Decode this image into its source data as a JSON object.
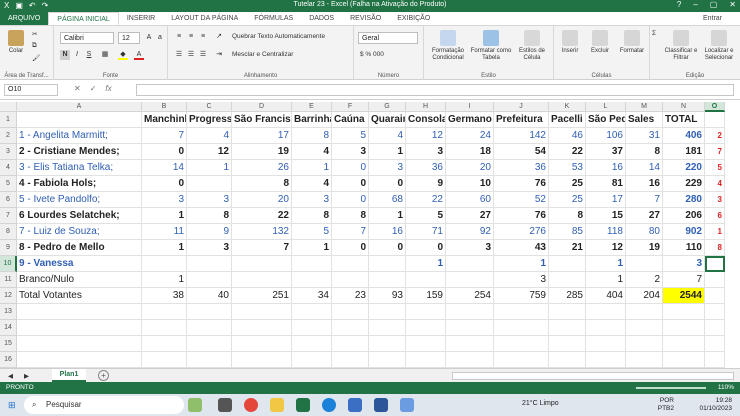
{
  "titlebar": {
    "title": "Tutelar 23 - Excel (Falha na Ativação do Produto)"
  },
  "tabs": [
    "ARQUIVO",
    "PÁGINA INICIAL",
    "INSERIR",
    "LAYOUT DA PÁGINA",
    "FÓRMULAS",
    "DADOS",
    "REVISÃO",
    "EXIBIÇÃO"
  ],
  "signin": "Entrar",
  "ribbon": {
    "paste": "Colar",
    "clipboard": "Área de Transf...",
    "font_name": "Calibri",
    "font_size": "12",
    "font_group": "Fonte",
    "wrap": "Quebrar Texto Automaticamente",
    "merge": "Mesclar e Centralizar",
    "align_group": "Alinhamento",
    "number_format": "Geral",
    "number_group": "Número",
    "cond_format": "Formatação Condicional",
    "format_table": "Formatar como Tabela",
    "cell_styles": "Estilos de Célula",
    "styles_group": "Estilo",
    "insert": "Inserir",
    "delete": "Excluir",
    "format": "Formatar",
    "cells_group": "Células",
    "sort": "Classificar e Filtrar",
    "find": "Localizar e Selecionar",
    "edit_group": "Edição"
  },
  "formula_bar": {
    "name_box": "O10",
    "fx": "fx",
    "value": ""
  },
  "columns": [
    "A",
    "B",
    "C",
    "D",
    "E",
    "F",
    "G",
    "H",
    "I",
    "J",
    "K",
    "L",
    "M",
    "N",
    "O"
  ],
  "rows": [
    {
      "n": "1",
      "cells": [
        "",
        "Manchinha",
        "Progresso",
        "São Francisco",
        "Barrinha",
        "Caúna",
        "Quarain",
        "Consolação",
        "Germano",
        "Prefeitura",
        "Pacelli",
        "São Pedro",
        "Sales",
        "TOTAL",
        ""
      ]
    },
    {
      "n": "2",
      "cells": [
        "1 - Angelita Marmitt;",
        "7",
        "4",
        "17",
        "8",
        "5",
        "4",
        "12",
        "24",
        "142",
        "46",
        "106",
        "31",
        "406",
        "2"
      ]
    },
    {
      "n": "3",
      "cells": [
        "2 - Cristiane Mendes;",
        "0",
        "12",
        "19",
        "4",
        "3",
        "1",
        "3",
        "18",
        "54",
        "22",
        "37",
        "8",
        "181",
        "7"
      ]
    },
    {
      "n": "4",
      "cells": [
        "3 - Elis Tatiana Telka;",
        "14",
        "1",
        "26",
        "1",
        "0",
        "3",
        "36",
        "20",
        "36",
        "53",
        "16",
        "14",
        "220",
        "5"
      ]
    },
    {
      "n": "5",
      "cells": [
        "4 - Fabiola Hols;",
        "0",
        "",
        "8",
        "4",
        "0",
        "0",
        "9",
        "10",
        "76",
        "25",
        "81",
        "16",
        "229",
        "4"
      ]
    },
    {
      "n": "6",
      "cells": [
        "5 - Ivete Pandolfo;",
        "3",
        "3",
        "20",
        "3",
        "0",
        "68",
        "22",
        "60",
        "52",
        "25",
        "17",
        "7",
        "280",
        "3"
      ]
    },
    {
      "n": "7",
      "cells": [
        "6 Lourdes Selatchek;",
        "1",
        "8",
        "22",
        "8",
        "8",
        "1",
        "5",
        "27",
        "76",
        "8",
        "15",
        "27",
        "206",
        "6"
      ]
    },
    {
      "n": "8",
      "cells": [
        "7 - Luiz de Souza;",
        "11",
        "9",
        "132",
        "5",
        "7",
        "16",
        "71",
        "92",
        "276",
        "85",
        "118",
        "80",
        "902",
        "1"
      ]
    },
    {
      "n": "9",
      "cells": [
        "8 - Pedro de Mello",
        "1",
        "3",
        "7",
        "1",
        "0",
        "0",
        "0",
        "3",
        "43",
        "21",
        "12",
        "19",
        "110",
        "8"
      ]
    },
    {
      "n": "10",
      "cells": [
        "9 - Vanessa",
        "",
        "",
        "",
        "",
        "",
        "",
        "1",
        "",
        "1",
        "",
        "1",
        "",
        "3",
        ""
      ]
    },
    {
      "n": "11",
      "cells": [
        "Branco/Nulo",
        "1",
        "",
        "",
        "",
        "",
        "",
        "",
        "",
        "3",
        "",
        "1",
        "2",
        "7",
        ""
      ]
    },
    {
      "n": "12",
      "cells": [
        "Total Votantes",
        "38",
        "40",
        "251",
        "34",
        "23",
        "93",
        "159",
        "254",
        "759",
        "285",
        "404",
        "204",
        "2544",
        ""
      ]
    },
    {
      "n": "13",
      "cells": [
        "",
        "",
        "",
        "",
        "",
        "",
        "",
        "",
        "",
        "",
        "",
        "",
        "",
        "",
        ""
      ]
    },
    {
      "n": "14",
      "cells": [
        "",
        "",
        "",
        "",
        "",
        "",
        "",
        "",
        "",
        "",
        "",
        "",
        "",
        "",
        ""
      ]
    },
    {
      "n": "15",
      "cells": [
        "",
        "",
        "",
        "",
        "",
        "",
        "",
        "",
        "",
        "",
        "",
        "",
        "",
        "",
        ""
      ]
    },
    {
      "n": "16",
      "cells": [
        "",
        "",
        "",
        "",
        "",
        "",
        "",
        "",
        "",
        "",
        "",
        "",
        "",
        "",
        ""
      ]
    },
    {
      "n": "17",
      "cells": [
        "",
        "",
        "",
        "",
        "",
        "",
        "",
        "",
        "",
        "",
        "",
        "",
        "",
        "",
        ""
      ]
    },
    {
      "n": "18",
      "cells": [
        "",
        "",
        "",
        "",
        "",
        "",
        "",
        "",
        "",
        "",
        "",
        "",
        "",
        "",
        ""
      ]
    }
  ],
  "sheet_tab": "Plan1",
  "status": {
    "ready": "PRONTO",
    "zoom": "110%"
  },
  "taskbar": {
    "search": "Pesquisar",
    "weather": "21°C  Limpo",
    "lang": "POR",
    "layout": "PTB2",
    "time": "19:28",
    "date": "01/10/2023"
  },
  "colors": {
    "excel_green": "#217346",
    "blue_text": "#2f5fb3",
    "rank_red": "#e02020",
    "highlight": "#ffff00"
  }
}
